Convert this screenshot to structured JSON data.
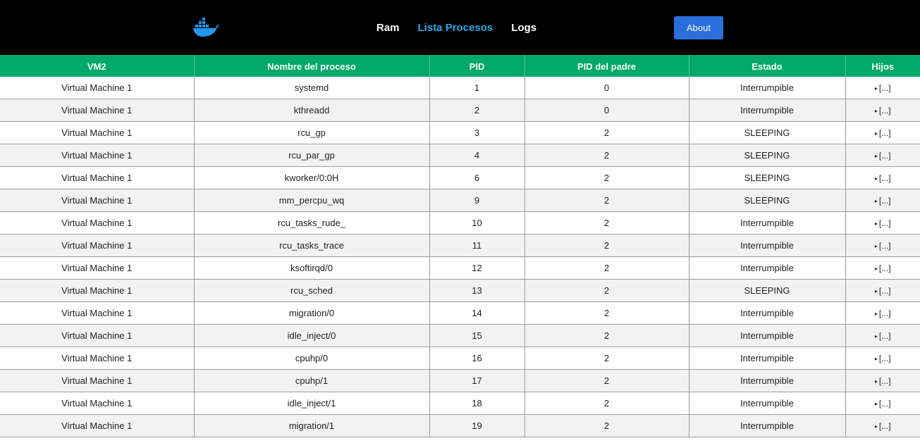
{
  "nav": {
    "links": [
      {
        "label": "Ram",
        "active": false
      },
      {
        "label": "Lista Procesos",
        "active": true
      },
      {
        "label": "Logs",
        "active": false
      }
    ],
    "about_label": "About",
    "logo_icon": "docker-whale-icon",
    "active_color": "#2aa7e8"
  },
  "table": {
    "headers": [
      "VM2",
      "Nombre del proceso",
      "PID",
      "PID del padre",
      "Estado",
      "Hijos"
    ],
    "header_color": "#00a86b",
    "children_toggle": "[...]",
    "rows": [
      {
        "vm": "Virtual Machine 1",
        "name": "systemd",
        "pid": "1",
        "ppid": "0",
        "state": "Interrumpible"
      },
      {
        "vm": "Virtual Machine 1",
        "name": "kthreadd",
        "pid": "2",
        "ppid": "0",
        "state": "Interrumpible"
      },
      {
        "vm": "Virtual Machine 1",
        "name": "rcu_gp",
        "pid": "3",
        "ppid": "2",
        "state": "SLEEPING"
      },
      {
        "vm": "Virtual Machine 1",
        "name": "rcu_par_gp",
        "pid": "4",
        "ppid": "2",
        "state": "SLEEPING"
      },
      {
        "vm": "Virtual Machine 1",
        "name": "kworker/0:0H",
        "pid": "6",
        "ppid": "2",
        "state": "SLEEPING"
      },
      {
        "vm": "Virtual Machine 1",
        "name": "mm_percpu_wq",
        "pid": "9",
        "ppid": "2",
        "state": "SLEEPING"
      },
      {
        "vm": "Virtual Machine 1",
        "name": "rcu_tasks_rude_",
        "pid": "10",
        "ppid": "2",
        "state": "Interrumpible"
      },
      {
        "vm": "Virtual Machine 1",
        "name": "rcu_tasks_trace",
        "pid": "11",
        "ppid": "2",
        "state": "Interrumpible"
      },
      {
        "vm": "Virtual Machine 1",
        "name": "ksoftirqd/0",
        "pid": "12",
        "ppid": "2",
        "state": "Interrumpible"
      },
      {
        "vm": "Virtual Machine 1",
        "name": "rcu_sched",
        "pid": "13",
        "ppid": "2",
        "state": "SLEEPING"
      },
      {
        "vm": "Virtual Machine 1",
        "name": "migration/0",
        "pid": "14",
        "ppid": "2",
        "state": "Interrumpible"
      },
      {
        "vm": "Virtual Machine 1",
        "name": "idle_inject/0",
        "pid": "15",
        "ppid": "2",
        "state": "Interrumpible"
      },
      {
        "vm": "Virtual Machine 1",
        "name": "cpuhp/0",
        "pid": "16",
        "ppid": "2",
        "state": "Interrumpible"
      },
      {
        "vm": "Virtual Machine 1",
        "name": "cpuhp/1",
        "pid": "17",
        "ppid": "2",
        "state": "Interrumpible"
      },
      {
        "vm": "Virtual Machine 1",
        "name": "idle_inject/1",
        "pid": "18",
        "ppid": "2",
        "state": "Interrumpible"
      },
      {
        "vm": "Virtual Machine 1",
        "name": "migration/1",
        "pid": "19",
        "ppid": "2",
        "state": "Interrumpible"
      }
    ]
  }
}
